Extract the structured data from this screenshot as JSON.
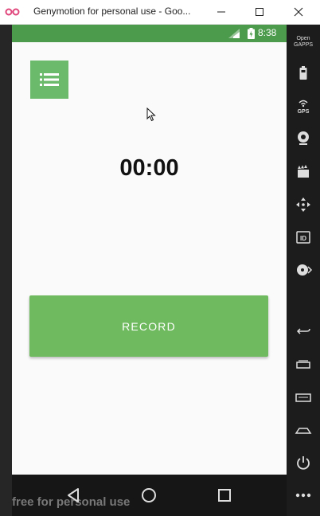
{
  "window": {
    "title": "Genymotion for personal use - Goo...",
    "minimize_icon": "minimize-icon",
    "maximize_icon": "maximize-icon",
    "close_icon": "close-icon"
  },
  "statusbar": {
    "time": "8:38",
    "icons": [
      "signal-icon",
      "battery-charging-icon"
    ]
  },
  "app": {
    "menu_icon": "list-icon",
    "timer": "00:00",
    "record_label": "RECORD",
    "accent_color": "#6fba5e",
    "statusbar_color": "#4c9a4c"
  },
  "navbar": {
    "buttons": [
      "back-icon",
      "home-icon",
      "recents-icon"
    ],
    "watermark": "free for personal use"
  },
  "toolbar": {
    "opengapps_label": "Open GAPPS",
    "gps_label": "GPS",
    "id_label": "ID",
    "tools": [
      "opengapps-icon",
      "battery-icon",
      "gps-icon",
      "camera-icon",
      "clapperboard-icon",
      "move-icon",
      "id-icon",
      "disk-icon",
      "back-icon",
      "recents-icon",
      "menu-icon",
      "home-icon",
      "power-icon",
      "more-icon"
    ]
  }
}
